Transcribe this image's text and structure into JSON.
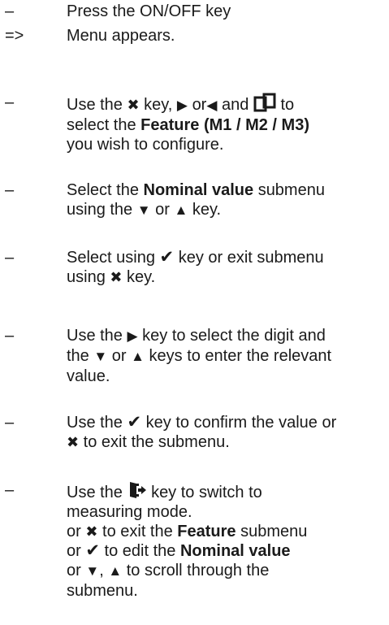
{
  "steps": [
    {
      "marker": "–",
      "line1": "Press the ON/OFF key"
    },
    {
      "marker": "=>",
      "line1": "Menu appears."
    },
    {
      "marker": "–",
      "p1": "Use the",
      "p2": "key,",
      "p3": "or",
      "p4": "and",
      "p5": "to",
      "p6": "select the",
      "b1": "Feature (M1 / M2 / M3)",
      "p7": "you wish to configure."
    },
    {
      "marker": "–",
      "p1": "Select the",
      "b1": "Nominal value",
      "p2": "submenu",
      "p3": "using the",
      "p4": "or",
      "p5": "key."
    },
    {
      "marker": "–",
      "p1": "Select using",
      "p2": "key or exit submenu",
      "p3": "using",
      "p4": "key."
    },
    {
      "marker": "–",
      "p1": "Use the",
      "p2": "key to select the digit and",
      "p3": "the",
      "p4": "or",
      "p5": "keys to enter the relevant",
      "p6": "value."
    },
    {
      "marker": "–",
      "p1": "Use the",
      "p2": "key to confirm the value or",
      "p3": "to exit the submenu."
    },
    {
      "marker": "–",
      "p1": "Use the",
      "p2": "key to switch to",
      "p3": "measuring mode.",
      "p4": "or",
      "p5": "to exit the",
      "b1": "Feature",
      "p6": "submenu",
      "p7": "or",
      "p8": "to edit the",
      "b2": "Nominal value",
      "p9": "or",
      "p10": ",",
      "p11": "to scroll through the",
      "p12": "submenu."
    }
  ],
  "icons": {
    "cross": "✖",
    "check": "✔",
    "right": "▶",
    "left": "◀",
    "down": "▼",
    "up": "▲",
    "pages_icon": "pages-icon",
    "exit_icon": "exit-door-icon"
  },
  "colors": {
    "text": "#1a1a1a",
    "background": "#ffffff"
  }
}
